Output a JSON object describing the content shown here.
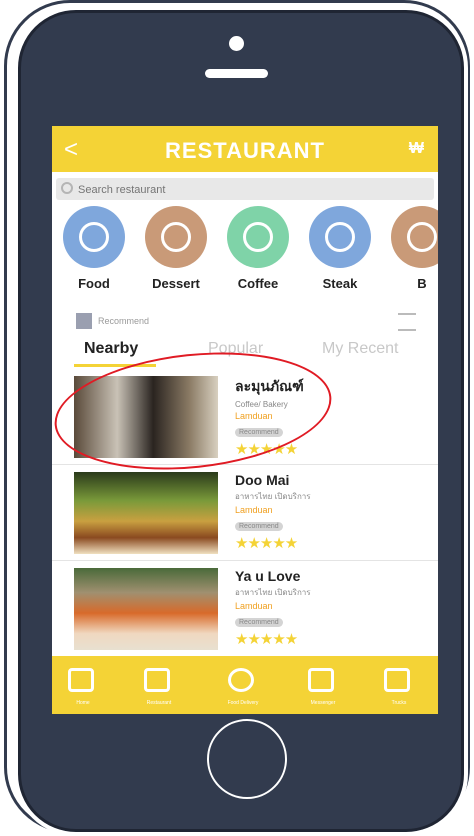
{
  "app": {
    "title": "RESTAURANT",
    "back_glyph": "<",
    "currency_glyph": "₩"
  },
  "search": {
    "placeholder": "Search restaurant"
  },
  "categories": [
    {
      "label": "Food",
      "icon": "cloche-icon",
      "color": "#7fa7dc"
    },
    {
      "label": "Dessert",
      "icon": "ice-cream-icon",
      "color": "#c99a78"
    },
    {
      "label": "Coffee",
      "icon": "coffee-cup-icon",
      "color": "#7fd3a8"
    },
    {
      "label": "Steak",
      "icon": "steak-icon",
      "color": "#7fa7dc"
    },
    {
      "label": "B",
      "icon": "burger-icon",
      "color": "#c99a78"
    }
  ],
  "recommend": {
    "label": "Recommend"
  },
  "tabs": [
    {
      "label": "Nearby",
      "active": true
    },
    {
      "label": "Popular",
      "active": false
    },
    {
      "label": "My Recent",
      "active": false
    }
  ],
  "restaurants": [
    {
      "name": "ละมุนภัณฑ์",
      "subtitle": "Coffee/ Bakery",
      "location": "Lamduan",
      "tag": "Recommend",
      "rating": "★★★★★"
    },
    {
      "name": "Doo Mai",
      "subtitle": "อาหารไทย เปิดบริการ",
      "location": "Lamduan",
      "tag": "Recommend",
      "rating": "★★★★★"
    },
    {
      "name": "Ya u Love",
      "subtitle": "อาหารไทย เปิดบริการ",
      "location": "Lamduan",
      "tag": "Recommend",
      "rating": "★★★★★"
    }
  ],
  "bottom_nav": [
    {
      "icon": "home-icon",
      "caption": "Home"
    },
    {
      "icon": "store-icon",
      "caption": "Restaurant"
    },
    {
      "icon": "dining-icon",
      "caption": "Food Delivery"
    },
    {
      "icon": "delivery-icon",
      "caption": "Messenger"
    },
    {
      "icon": "truck-icon",
      "caption": "Trucks"
    }
  ],
  "colors": {
    "accent": "#f4d336",
    "phone_body": "#323b4e",
    "highlight": "#e01b24"
  }
}
